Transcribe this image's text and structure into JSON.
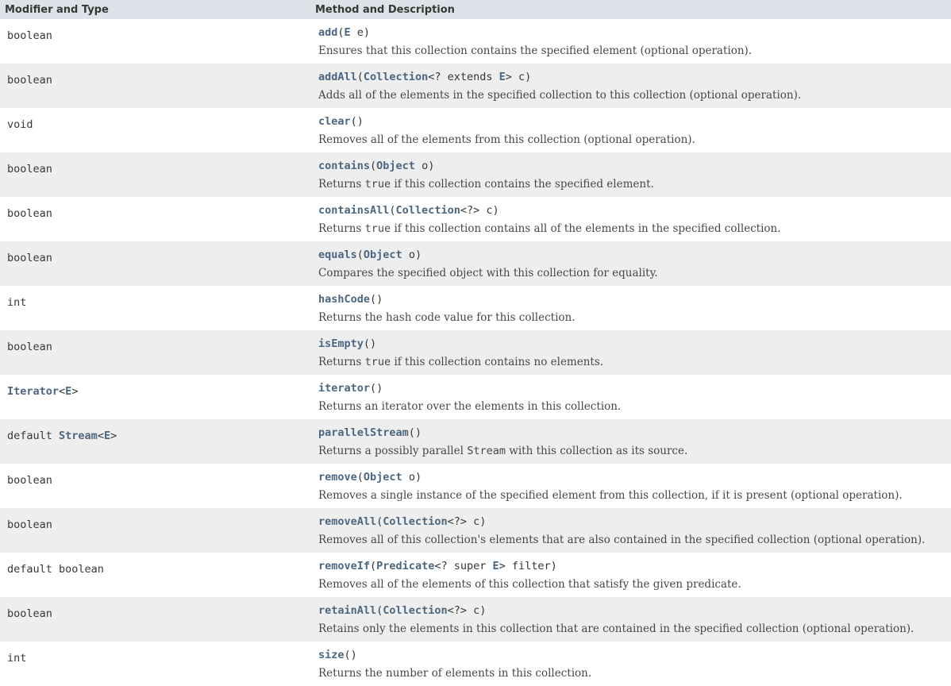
{
  "header": {
    "col1": "Modifier and Type",
    "col2": "Method and Description"
  },
  "colors": {
    "header_bg": "#dee3e9",
    "alt_row_bg": "#eeeeef",
    "link": "#4a6782",
    "text": "#353833"
  },
  "rows": [
    {
      "modifier": [
        {
          "t": "boolean"
        }
      ],
      "method": [
        {
          "t": "add",
          "link": true
        },
        {
          "t": "("
        },
        {
          "t": "E",
          "link": true
        },
        {
          "t": " e)"
        }
      ],
      "description": [
        {
          "t": "Ensures that this collection contains the specified element (optional operation)."
        }
      ]
    },
    {
      "modifier": [
        {
          "t": "boolean"
        }
      ],
      "method": [
        {
          "t": "addAll",
          "link": true
        },
        {
          "t": "("
        },
        {
          "t": "Collection",
          "link": true
        },
        {
          "t": "<? extends "
        },
        {
          "t": "E",
          "link": true
        },
        {
          "t": "> c)"
        }
      ],
      "description": [
        {
          "t": "Adds all of the elements in the specified collection to this collection (optional operation)."
        }
      ]
    },
    {
      "modifier": [
        {
          "t": "void"
        }
      ],
      "method": [
        {
          "t": "clear",
          "link": true
        },
        {
          "t": "()"
        }
      ],
      "description": [
        {
          "t": "Removes all of the elements from this collection (optional operation)."
        }
      ]
    },
    {
      "modifier": [
        {
          "t": "boolean"
        }
      ],
      "method": [
        {
          "t": "contains",
          "link": true
        },
        {
          "t": "("
        },
        {
          "t": "Object",
          "link": true
        },
        {
          "t": " o)"
        }
      ],
      "description": [
        {
          "t": "Returns "
        },
        {
          "t": "true",
          "code": true
        },
        {
          "t": " if this collection contains the specified element."
        }
      ]
    },
    {
      "modifier": [
        {
          "t": "boolean"
        }
      ],
      "method": [
        {
          "t": "containsAll",
          "link": true
        },
        {
          "t": "("
        },
        {
          "t": "Collection",
          "link": true
        },
        {
          "t": "<?> c)"
        }
      ],
      "description": [
        {
          "t": "Returns "
        },
        {
          "t": "true",
          "code": true
        },
        {
          "t": " if this collection contains all of the elements in the specified collection."
        }
      ]
    },
    {
      "modifier": [
        {
          "t": "boolean"
        }
      ],
      "method": [
        {
          "t": "equals",
          "link": true
        },
        {
          "t": "("
        },
        {
          "t": "Object",
          "link": true
        },
        {
          "t": " o)"
        }
      ],
      "description": [
        {
          "t": "Compares the specified object with this collection for equality."
        }
      ]
    },
    {
      "modifier": [
        {
          "t": "int"
        }
      ],
      "method": [
        {
          "t": "hashCode",
          "link": true
        },
        {
          "t": "()"
        }
      ],
      "description": [
        {
          "t": "Returns the hash code value for this collection."
        }
      ]
    },
    {
      "modifier": [
        {
          "t": "boolean"
        }
      ],
      "method": [
        {
          "t": "isEmpty",
          "link": true
        },
        {
          "t": "()"
        }
      ],
      "description": [
        {
          "t": "Returns "
        },
        {
          "t": "true",
          "code": true
        },
        {
          "t": " if this collection contains no elements."
        }
      ]
    },
    {
      "modifier": [
        {
          "t": "Iterator",
          "link": true
        },
        {
          "t": "<"
        },
        {
          "t": "E",
          "link": true
        },
        {
          "t": ">"
        }
      ],
      "method": [
        {
          "t": "iterator",
          "link": true
        },
        {
          "t": "()"
        }
      ],
      "description": [
        {
          "t": "Returns an iterator over the elements in this collection."
        }
      ]
    },
    {
      "modifier": [
        {
          "t": "default "
        },
        {
          "t": "Stream",
          "link": true
        },
        {
          "t": "<"
        },
        {
          "t": "E",
          "link": true
        },
        {
          "t": ">"
        }
      ],
      "method": [
        {
          "t": "parallelStream",
          "link": true
        },
        {
          "t": "()"
        }
      ],
      "description": [
        {
          "t": "Returns a possibly parallel "
        },
        {
          "t": "Stream",
          "code": true
        },
        {
          "t": " with this collection as its source."
        }
      ]
    },
    {
      "modifier": [
        {
          "t": "boolean"
        }
      ],
      "method": [
        {
          "t": "remove",
          "link": true
        },
        {
          "t": "("
        },
        {
          "t": "Object",
          "link": true
        },
        {
          "t": " o)"
        }
      ],
      "description": [
        {
          "t": "Removes a single instance of the specified element from this collection, if it is present (optional operation)."
        }
      ]
    },
    {
      "modifier": [
        {
          "t": "boolean"
        }
      ],
      "method": [
        {
          "t": "removeAll",
          "link": true
        },
        {
          "t": "("
        },
        {
          "t": "Collection",
          "link": true
        },
        {
          "t": "<?> c)"
        }
      ],
      "description": [
        {
          "t": "Removes all of this collection's elements that are also contained in the specified collection (optional operation)."
        }
      ]
    },
    {
      "modifier": [
        {
          "t": "default boolean"
        }
      ],
      "method": [
        {
          "t": "removeIf",
          "link": true
        },
        {
          "t": "("
        },
        {
          "t": "Predicate",
          "link": true
        },
        {
          "t": "<? super "
        },
        {
          "t": "E",
          "link": true
        },
        {
          "t": "> filter)"
        }
      ],
      "description": [
        {
          "t": "Removes all of the elements of this collection that satisfy the given predicate."
        }
      ]
    },
    {
      "modifier": [
        {
          "t": "boolean"
        }
      ],
      "method": [
        {
          "t": "retainAll",
          "link": true
        },
        {
          "t": "("
        },
        {
          "t": "Collection",
          "link": true
        },
        {
          "t": "<?> c)"
        }
      ],
      "description": [
        {
          "t": "Retains only the elements in this collection that are contained in the specified collection (optional operation)."
        }
      ]
    },
    {
      "modifier": [
        {
          "t": "int"
        }
      ],
      "method": [
        {
          "t": "size",
          "link": true
        },
        {
          "t": "()"
        }
      ],
      "description": [
        {
          "t": "Returns the number of elements in this collection."
        }
      ]
    }
  ]
}
